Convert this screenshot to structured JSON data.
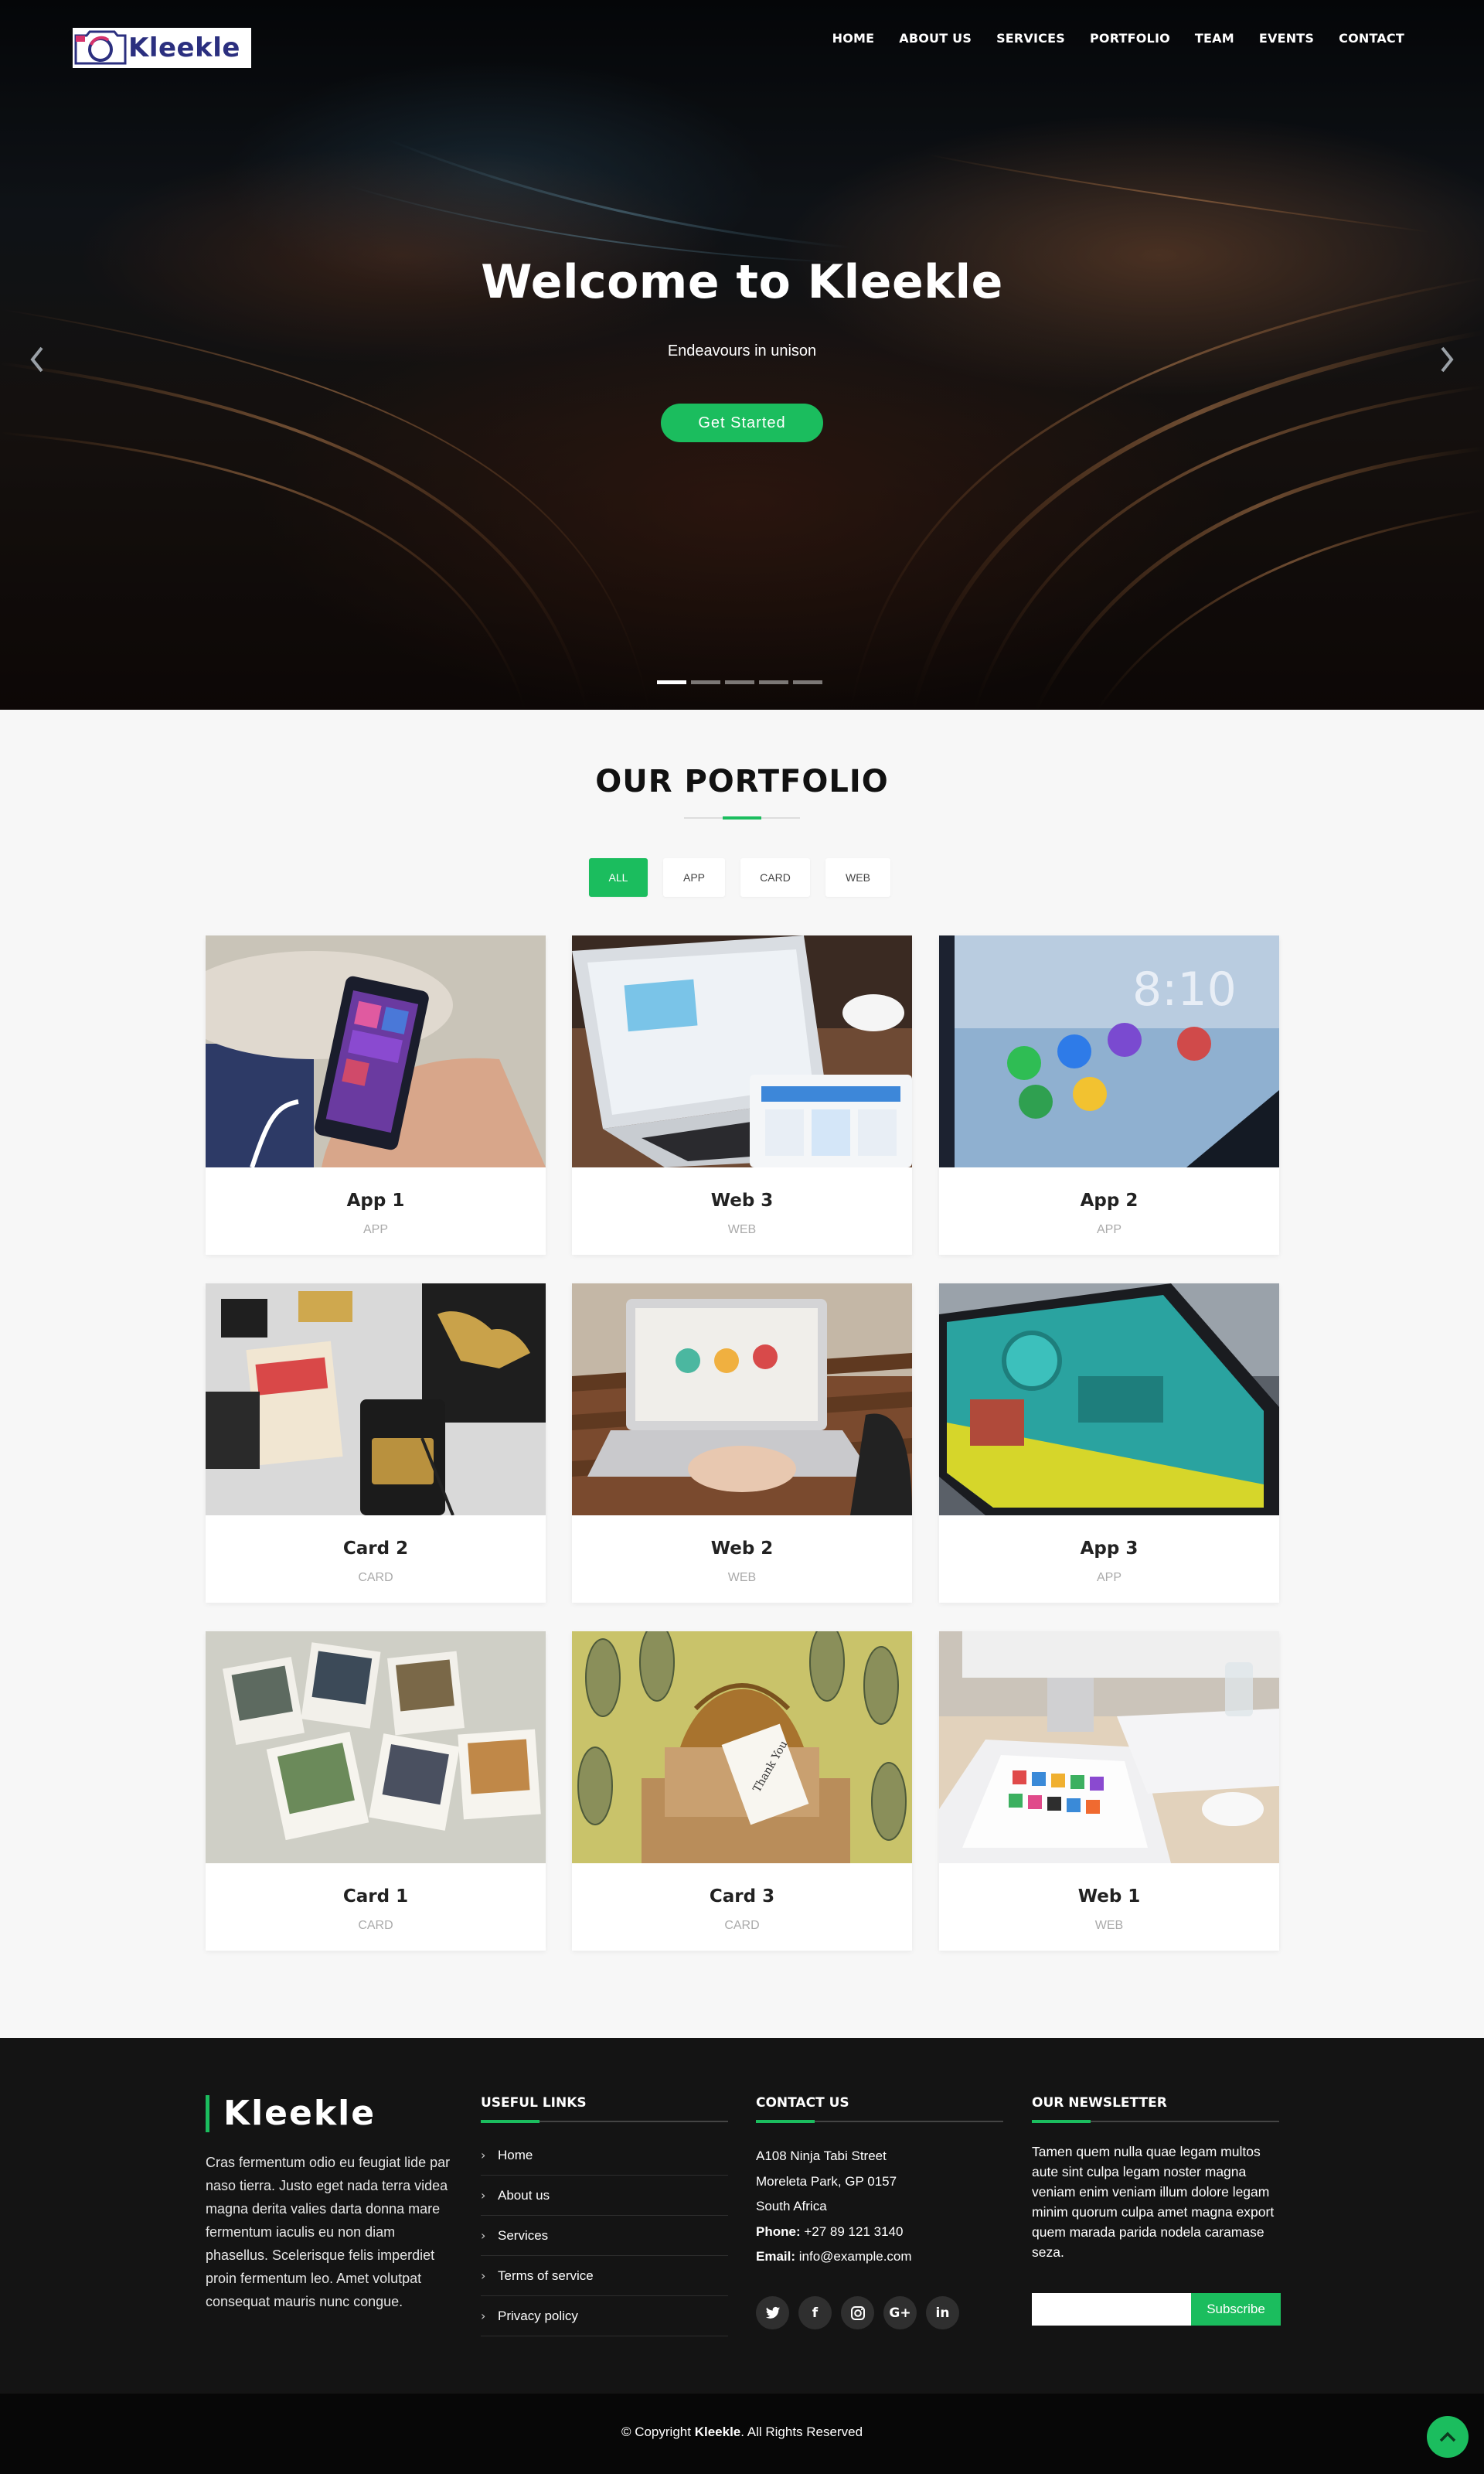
{
  "brand": {
    "logo_text": "Kleekle",
    "accent": "#1bbd5e",
    "dark": "#141414"
  },
  "nav": {
    "items": [
      {
        "label": "HOME"
      },
      {
        "label": "ABOUT US"
      },
      {
        "label": "SERVICES"
      },
      {
        "label": "PORTFOLIO"
      },
      {
        "label": "TEAM"
      },
      {
        "label": "EVENTS"
      },
      {
        "label": "CONTACT"
      }
    ]
  },
  "hero": {
    "title": "Welcome to Kleekle",
    "subtitle": "Endeavours in unison",
    "cta_label": "Get Started",
    "prev_icon": "chevron-left-icon",
    "next_icon": "chevron-right-icon",
    "slide_count": 5,
    "active_slide": 1
  },
  "portfolio": {
    "title": "OUR PORTFOLIO",
    "filters": [
      {
        "label": "ALL",
        "active": true
      },
      {
        "label": "APP",
        "active": false
      },
      {
        "label": "CARD",
        "active": false
      },
      {
        "label": "WEB",
        "active": false
      }
    ],
    "items": [
      {
        "title": "App 1",
        "category": "APP"
      },
      {
        "title": "Web 3",
        "category": "WEB"
      },
      {
        "title": "App 2",
        "category": "APP"
      },
      {
        "title": "Card 2",
        "category": "CARD"
      },
      {
        "title": "Web 2",
        "category": "WEB"
      },
      {
        "title": "App 3",
        "category": "APP"
      },
      {
        "title": "Card 1",
        "category": "CARD"
      },
      {
        "title": "Card 3",
        "category": "CARD"
      },
      {
        "title": "Web 1",
        "category": "WEB"
      }
    ]
  },
  "footer": {
    "brand": "Kleekle",
    "about": "Cras fermentum odio eu feugiat lide par naso tierra. Justo eget nada terra videa magna derita valies darta donna mare fermentum iaculis eu non diam phasellus. Scelerisque felis imperdiet proin fermentum leo. Amet volutpat consequat mauris nunc congue.",
    "links_heading": "USEFUL LINKS",
    "links": [
      {
        "label": "Home"
      },
      {
        "label": "About us"
      },
      {
        "label": "Services"
      },
      {
        "label": "Terms of service"
      },
      {
        "label": "Privacy policy"
      }
    ],
    "contact_heading": "CONTACT US",
    "contact": {
      "address_line1": "A108 Ninja Tabi Street",
      "address_line2": "Moreleta Park, GP 0157",
      "address_line3": "South Africa",
      "phone_label": "Phone:",
      "phone": "+27 89 121 3140",
      "email_label": "Email:",
      "email": "info@example.com"
    },
    "socials": [
      {
        "icon": "twitter-icon",
        "glyph": "🐦"
      },
      {
        "icon": "facebook-icon",
        "glyph": "f"
      },
      {
        "icon": "instagram-icon",
        "glyph": "◎"
      },
      {
        "icon": "google-plus-icon",
        "glyph": "G+"
      },
      {
        "icon": "linkedin-icon",
        "glyph": "in"
      }
    ],
    "newsletter_heading": "OUR NEWSLETTER",
    "newsletter_text": "Tamen quem nulla quae legam multos aute sint culpa legam noster magna veniam enim veniam illum dolore legam minim quorum culpa amet magna export quem marada parida nodela caramase seza.",
    "subscribe_label": "Subscribe",
    "copyright_prefix": "© Copyright",
    "copyright_brand": "Kleekle",
    "copyright_suffix": ". All Rights Reserved",
    "back_to_top_icon": "chevron-up-icon"
  }
}
